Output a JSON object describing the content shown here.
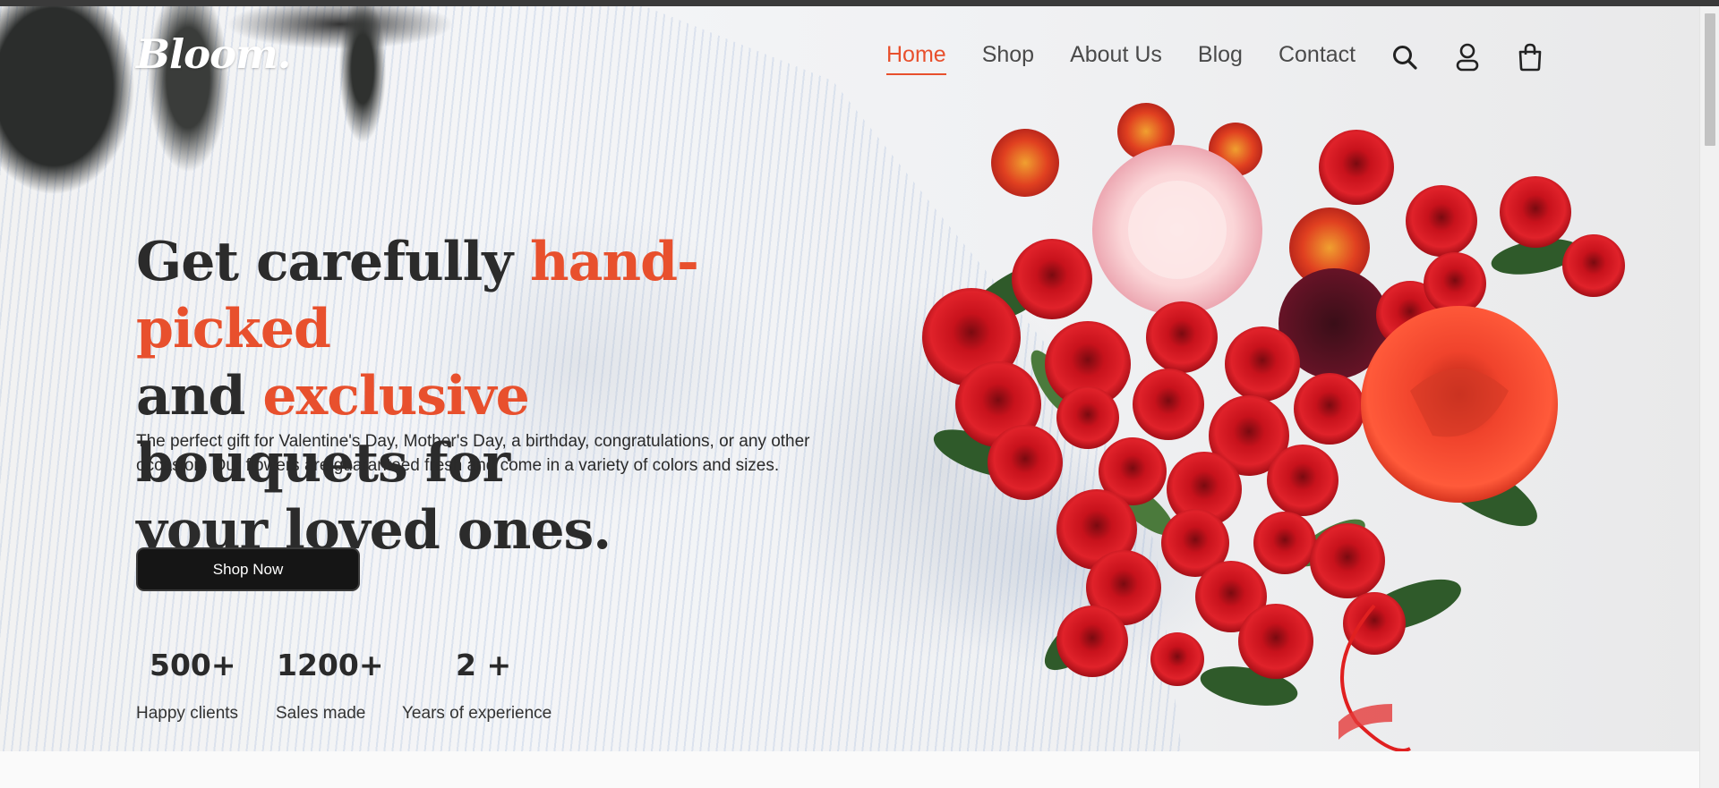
{
  "brand": {
    "logo": "Bloom.",
    "accent_color": "#e8502d",
    "dark_color": "#2b2b2b"
  },
  "nav": {
    "links": [
      {
        "label": "Home",
        "active": true
      },
      {
        "label": "Shop",
        "active": false
      },
      {
        "label": "About Us",
        "active": false
      },
      {
        "label": "Blog",
        "active": false
      },
      {
        "label": "Contact",
        "active": false
      }
    ],
    "icons": [
      "search-icon",
      "user-icon",
      "shopping-bag-icon"
    ]
  },
  "hero": {
    "headline": {
      "part1": "Get carefully ",
      "accent1": "hand-picked",
      "part2": "and ",
      "accent2": "exclusive",
      "part3": " bouquets for",
      "part4": "your loved ones."
    },
    "subtext": "The perfect gift for Valentine's Day, Mother's Day, a birthday, congratulations, or any other occasion. Our flowers are guaranteed fresh and come in a variety of colors and sizes.",
    "cta_label": "Shop Now",
    "stats": [
      {
        "value": "500+",
        "label": "Happy clients"
      },
      {
        "value": "1200+",
        "label": "Sales made"
      },
      {
        "value": "2 +",
        "label": "Years of experience"
      }
    ]
  }
}
